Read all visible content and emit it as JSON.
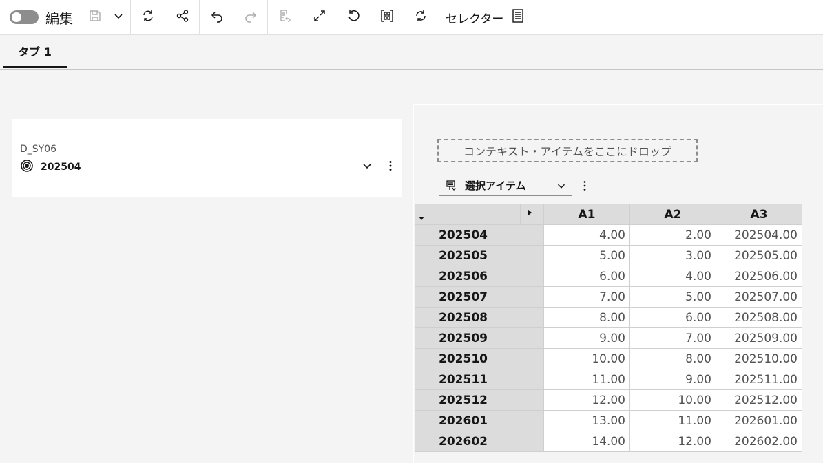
{
  "toolbar": {
    "edit_label": "編集",
    "selector_label": "セレクター"
  },
  "tabs": [
    {
      "label": "タブ 1"
    }
  ],
  "card": {
    "label": "D_SY06",
    "value": "202504"
  },
  "panel": {
    "dropzone_text": "コンテキスト・アイテムをここにドロップ",
    "selected_item_label": "選択アイテム"
  },
  "table": {
    "columns": [
      "A1",
      "A2",
      "A3"
    ],
    "rows": [
      {
        "key": "202504",
        "values": [
          "4.00",
          "2.00",
          "202504.00"
        ]
      },
      {
        "key": "202505",
        "values": [
          "5.00",
          "3.00",
          "202505.00"
        ]
      },
      {
        "key": "202506",
        "values": [
          "6.00",
          "4.00",
          "202506.00"
        ]
      },
      {
        "key": "202507",
        "values": [
          "7.00",
          "5.00",
          "202507.00"
        ]
      },
      {
        "key": "202508",
        "values": [
          "8.00",
          "6.00",
          "202508.00"
        ]
      },
      {
        "key": "202509",
        "values": [
          "9.00",
          "7.00",
          "202509.00"
        ]
      },
      {
        "key": "202510",
        "values": [
          "10.00",
          "8.00",
          "202510.00"
        ]
      },
      {
        "key": "202511",
        "values": [
          "11.00",
          "9.00",
          "202511.00"
        ]
      },
      {
        "key": "202512",
        "values": [
          "12.00",
          "10.00",
          "202512.00"
        ]
      },
      {
        "key": "202601",
        "values": [
          "13.00",
          "11.00",
          "202601.00"
        ]
      },
      {
        "key": "202602",
        "values": [
          "14.00",
          "12.00",
          "202602.00"
        ]
      }
    ]
  }
}
